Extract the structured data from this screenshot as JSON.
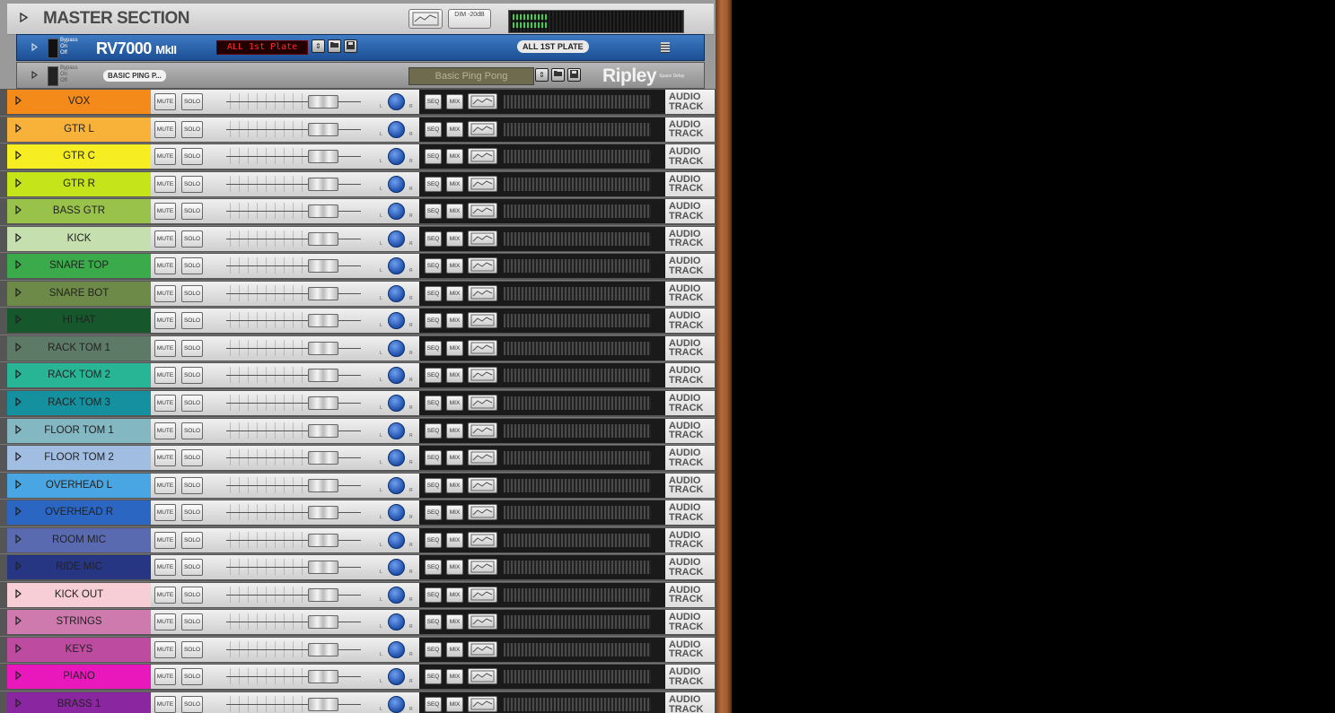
{
  "master": {
    "title": "MASTER SECTION",
    "dim_label": "DIM -20dB"
  },
  "rv7000": {
    "bypass_labels": [
      "Bypass",
      "On",
      "Off"
    ],
    "name": "RV7000",
    "name_suffix": "MkII",
    "patch_display": "ALL 1st Plate",
    "patch_label": "ALL 1ST PLATE"
  },
  "ripley": {
    "bypass_labels": [
      "Bypass",
      "On",
      "Off"
    ],
    "tag": "BASIC PING P...",
    "patch_display": "Basic Ping Pong",
    "brand": "Ripley",
    "brand_sub": "Space Delay"
  },
  "labels": {
    "mute": "MUTE",
    "solo": "SOLO",
    "seq": "SEQ",
    "mix": "MIX",
    "track_line1": "AUDIO",
    "track_line2": "TRACK"
  },
  "colors": {
    "rv_blue": "#2a64ad",
    "ripley_gray": "#a0a0a0",
    "meter_green": "#3cd34c"
  },
  "channels": [
    {
      "name": "VOX",
      "color": "#f48a1a"
    },
    {
      "name": "GTR L",
      "color": "#f8b23a"
    },
    {
      "name": "GTR C",
      "color": "#f6ee22"
    },
    {
      "name": "GTR R",
      "color": "#c6e41a"
    },
    {
      "name": "BASS GTR",
      "color": "#98c24a"
    },
    {
      "name": "KICK",
      "color": "#c6dfae"
    },
    {
      "name": "SNARE TOP",
      "color": "#3aaa4a"
    },
    {
      "name": "SNARE BOT",
      "color": "#6e8a48"
    },
    {
      "name": "HI HAT",
      "color": "#16572c"
    },
    {
      "name": "RACK TOM 1",
      "color": "#5d7a66"
    },
    {
      "name": "RACK TOM 2",
      "color": "#27b595"
    },
    {
      "name": "RACK TOM 3",
      "color": "#14909e"
    },
    {
      "name": "FLOOR TOM 1",
      "color": "#83b7c2"
    },
    {
      "name": "FLOOR TOM 2",
      "color": "#a2bde2"
    },
    {
      "name": "OVERHEAD L",
      "color": "#4aa6e2"
    },
    {
      "name": "OVERHEAD R",
      "color": "#2a66c2"
    },
    {
      "name": "ROOM MIC",
      "color": "#5a6ab0"
    },
    {
      "name": "RIDE MIC",
      "color": "#273683"
    },
    {
      "name": "KICK OUT",
      "color": "#f8ced6"
    },
    {
      "name": "STRINGS",
      "color": "#ce7aae"
    },
    {
      "name": "KEYS",
      "color": "#bd4ba0"
    },
    {
      "name": "PIANO",
      "color": "#e818bd"
    },
    {
      "name": "BRASS 1",
      "color": "#8a26a0"
    }
  ]
}
